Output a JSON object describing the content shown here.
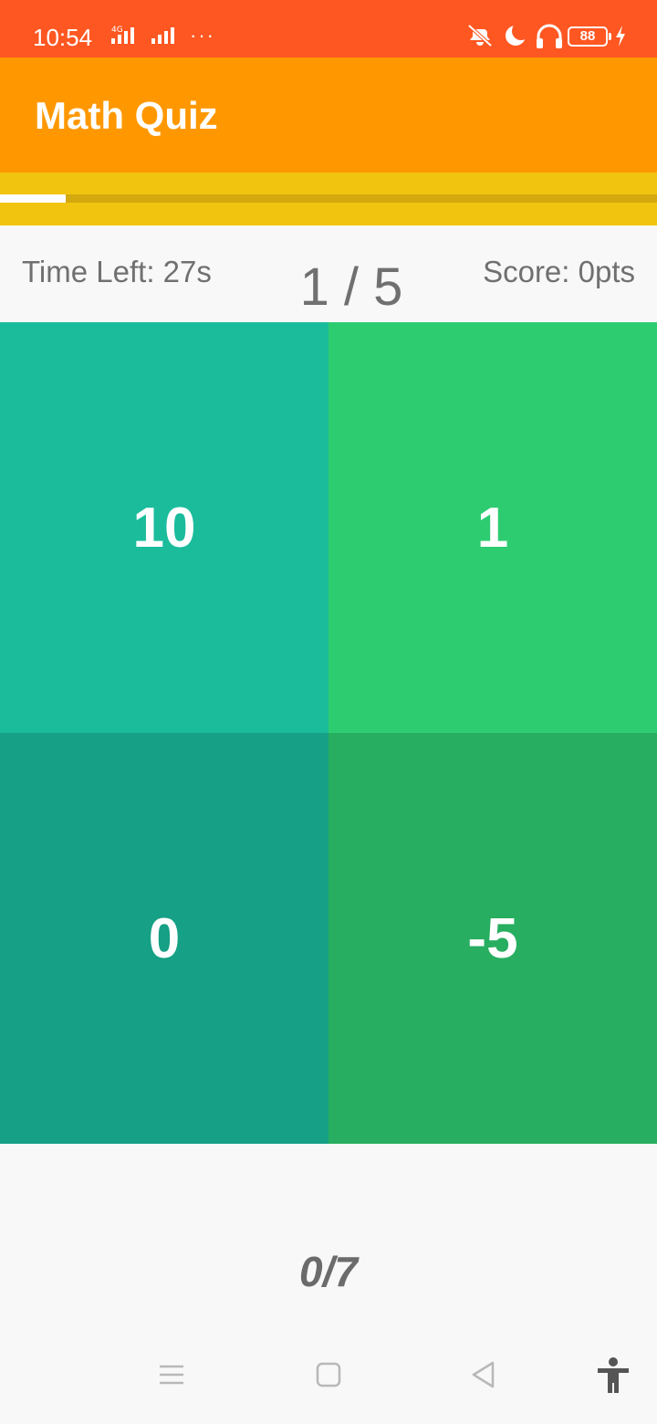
{
  "status_bar": {
    "time": "10:54",
    "network_label": "4G",
    "more_indicator": "···",
    "battery_level": "88",
    "icons": [
      "signal-4g-icon",
      "signal-icon",
      "vibrate-off-icon",
      "do-not-disturb-moon-icon",
      "headphones-icon",
      "battery-icon",
      "charging-bolt-icon"
    ]
  },
  "app_bar": {
    "title": "Math Quiz"
  },
  "progress": {
    "time_fraction_remaining": 0.1
  },
  "info": {
    "time_left": "Time Left: 27s",
    "question_counter": "1 / 5",
    "score": "Score: 0pts"
  },
  "answers": [
    {
      "value": "10",
      "color": "#1abc9c"
    },
    {
      "value": "1",
      "color": "#2ecc71"
    },
    {
      "value": "0",
      "color": "#16a085"
    },
    {
      "value": "-5",
      "color": "#27ae60"
    }
  ],
  "correct_counter": "0/7",
  "nav_bar": {
    "buttons": [
      "menu-icon",
      "home-square-icon",
      "back-triangle-icon",
      "accessibility-icon"
    ]
  },
  "colors": {
    "status_bar": "#ff5722",
    "app_bar": "#ff9800",
    "progress_band": "#f1c40f",
    "text_secondary": "#707070"
  }
}
